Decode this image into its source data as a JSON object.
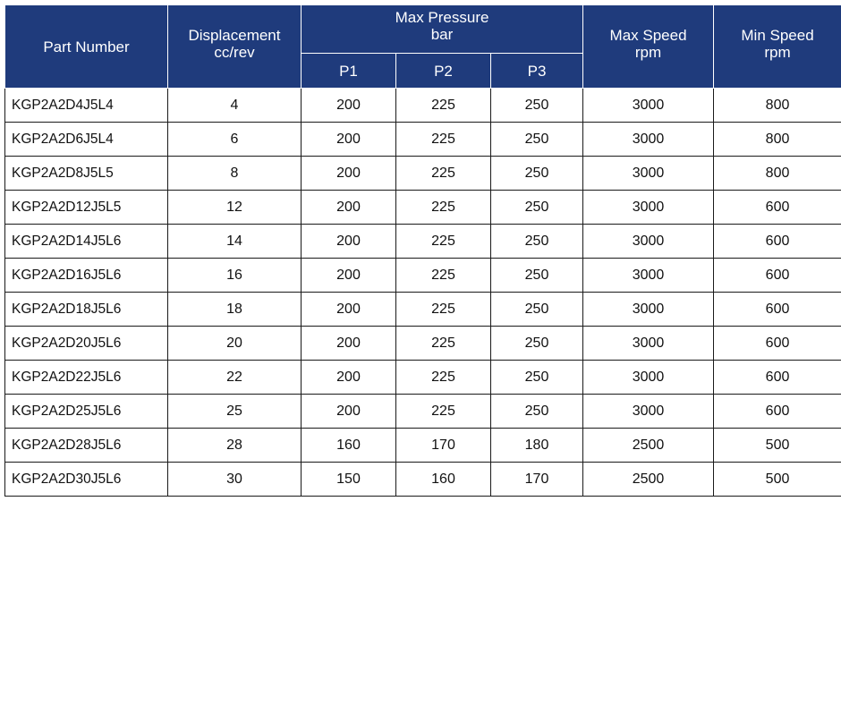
{
  "table": {
    "headers": {
      "part_number": "Part Number",
      "displacement": "Displacement",
      "displacement_unit": "cc/rev",
      "max_pressure": "Max Pressure",
      "max_pressure_unit": "bar",
      "p1": "P1",
      "p2": "P2",
      "p3": "P3",
      "max_speed": "Max Speed",
      "max_speed_unit": "rpm",
      "min_speed": "Min Speed",
      "min_speed_unit": "rpm"
    },
    "rows": [
      {
        "part": "KGP2A2D4J5L4",
        "disp": "4",
        "p1": "200",
        "p2": "225",
        "p3": "250",
        "max_speed": "3000",
        "min_speed": "800"
      },
      {
        "part": "KGP2A2D6J5L4",
        "disp": "6",
        "p1": "200",
        "p2": "225",
        "p3": "250",
        "max_speed": "3000",
        "min_speed": "800"
      },
      {
        "part": "KGP2A2D8J5L5",
        "disp": "8",
        "p1": "200",
        "p2": "225",
        "p3": "250",
        "max_speed": "3000",
        "min_speed": "800"
      },
      {
        "part": "KGP2A2D12J5L5",
        "disp": "12",
        "p1": "200",
        "p2": "225",
        "p3": "250",
        "max_speed": "3000",
        "min_speed": "600"
      },
      {
        "part": "KGP2A2D14J5L6",
        "disp": "14",
        "p1": "200",
        "p2": "225",
        "p3": "250",
        "max_speed": "3000",
        "min_speed": "600"
      },
      {
        "part": "KGP2A2D16J5L6",
        "disp": "16",
        "p1": "200",
        "p2": "225",
        "p3": "250",
        "max_speed": "3000",
        "min_speed": "600"
      },
      {
        "part": "KGP2A2D18J5L6",
        "disp": "18",
        "p1": "200",
        "p2": "225",
        "p3": "250",
        "max_speed": "3000",
        "min_speed": "600"
      },
      {
        "part": "KGP2A2D20J5L6",
        "disp": "20",
        "p1": "200",
        "p2": "225",
        "p3": "250",
        "max_speed": "3000",
        "min_speed": "600"
      },
      {
        "part": "KGP2A2D22J5L6",
        "disp": "22",
        "p1": "200",
        "p2": "225",
        "p3": "250",
        "max_speed": "3000",
        "min_speed": "600"
      },
      {
        "part": "KGP2A2D25J5L6",
        "disp": "25",
        "p1": "200",
        "p2": "225",
        "p3": "250",
        "max_speed": "3000",
        "min_speed": "600"
      },
      {
        "part": "KGP2A2D28J5L6",
        "disp": "28",
        "p1": "160",
        "p2": "170",
        "p3": "180",
        "max_speed": "2500",
        "min_speed": "500"
      },
      {
        "part": "KGP2A2D30J5L6",
        "disp": "30",
        "p1": "150",
        "p2": "160",
        "p3": "170",
        "max_speed": "2500",
        "min_speed": "500"
      }
    ]
  },
  "colors": {
    "header_bg": "#1f3b7c",
    "header_text": "#ffffff",
    "grid_line": "#1a1a1a"
  }
}
